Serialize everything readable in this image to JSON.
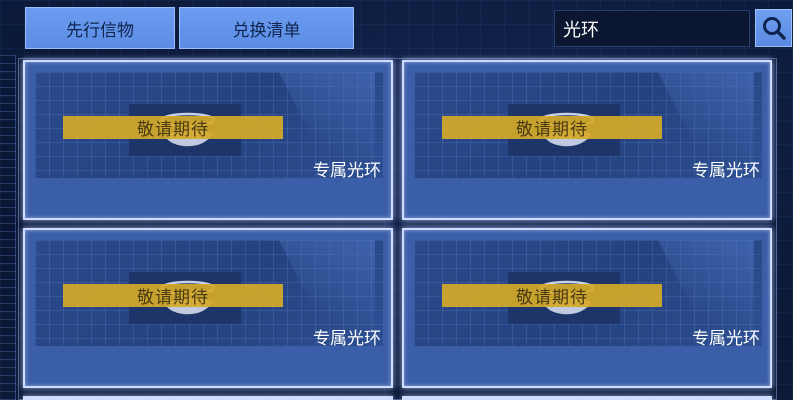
{
  "tabs": [
    {
      "label": "先行信物"
    },
    {
      "label": "兑换清单"
    }
  ],
  "search": {
    "value": "光环",
    "icon": "search-icon"
  },
  "cards": [
    {
      "badge": "敬请期待",
      "label": "专属光环"
    },
    {
      "badge": "敬请期待",
      "label": "专属光环"
    },
    {
      "badge": "敬请期待",
      "label": "专属光环"
    },
    {
      "badge": "敬请期待",
      "label": "专属光环"
    }
  ],
  "colors": {
    "accent": "#5b8de6",
    "card": "#3b5ea8",
    "badge": "#d6aa28",
    "background": "#0b1a3a"
  }
}
